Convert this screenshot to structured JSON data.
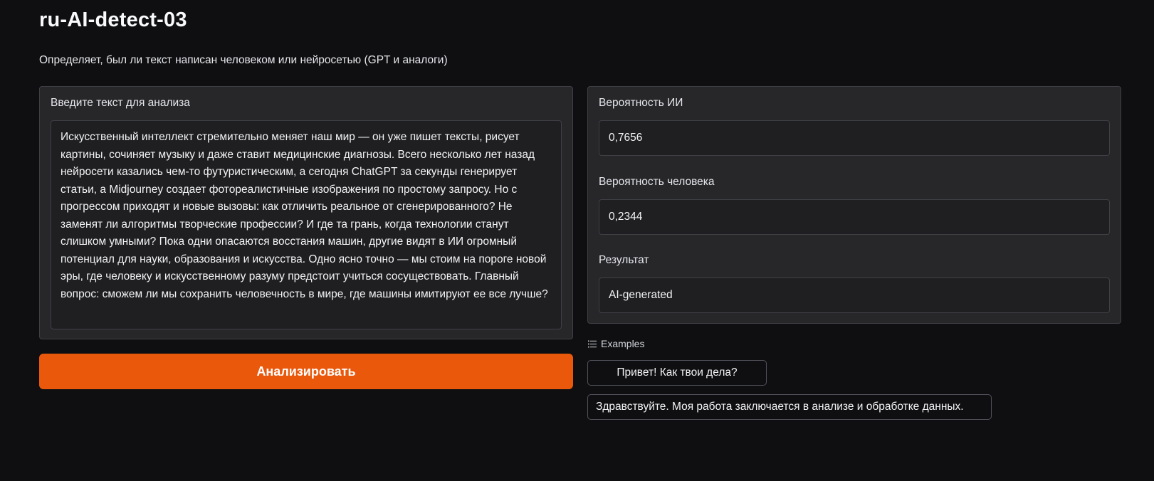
{
  "app": {
    "title": "ru-AI-detect-03",
    "description": "Определяет, был ли текст написан человеком или нейросетью (GPT и аналоги)"
  },
  "input": {
    "label": "Введите текст для анализа",
    "value": "Искусственный интеллект стремительно меняет наш мир — он уже пишет тексты, рисует картины, сочиняет музыку и даже ставит медицинские диагнозы. Всего несколько лет назад нейросети казались чем-то футуристическим, а сегодня ChatGPT за секунды генерирует статьи, а Midjourney создает фотореалистичные изображения по простому запросу. Но с прогрессом приходят и новые вызовы: как отличить реальное от сгенерированного? Не заменят ли алгоритмы творческие профессии? И где та грань, когда технологии станут слишком умными? Пока одни опасаются восстания машин, другие видят в ИИ огромный потенциал для науки, образования и искусства. Одно ясно точно — мы стоим на пороге новой эры, где человеку и искусственному разуму предстоит учиться сосуществовать. Главный вопрос: сможем ли мы сохранить человечность в мире, где машины имитируют ее все лучше?"
  },
  "outputs": {
    "ai_prob": {
      "label": "Вероятность ИИ",
      "value": "0,7656"
    },
    "human_prob": {
      "label": "Вероятность человека",
      "value": "0,2344"
    },
    "result": {
      "label": "Результат",
      "value": "AI-generated"
    }
  },
  "analyze_button": {
    "label": "Анализировать"
  },
  "examples": {
    "header": "Examples",
    "icon": "list-icon",
    "items": [
      "Привет! Как твои дела?",
      "Здравствуйте. Моя работа заключается в анализе и обработке данных."
    ]
  },
  "colors": {
    "accent": "#ea580c",
    "background": "#0f0f11",
    "panel": "#27272a"
  }
}
